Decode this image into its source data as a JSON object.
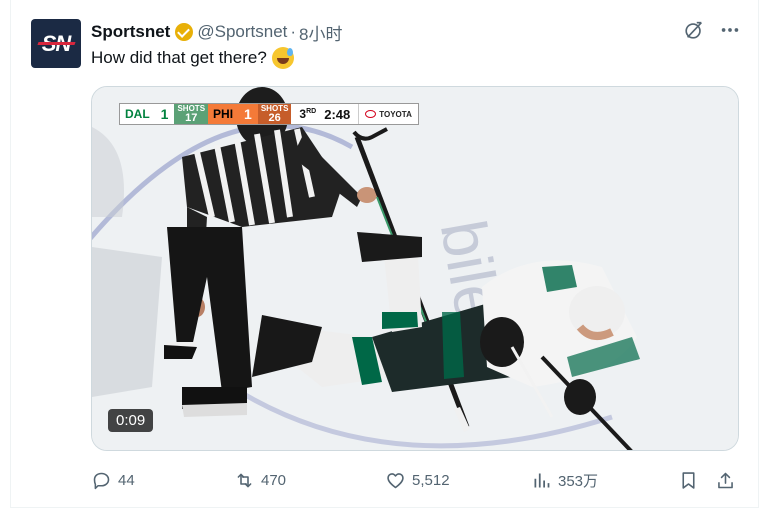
{
  "author": {
    "display_name": "Sportsnet",
    "handle": "@Sportsnet",
    "time": "8小时",
    "avatar_text": "SN",
    "verified_color": "#e8b008"
  },
  "tweet": {
    "text": "How did that get there?",
    "emoji": "sweat-smile-emoji"
  },
  "media": {
    "scorebug": {
      "team1": "DAL",
      "team1_score": "1",
      "team1_shots_label": "SHOTS",
      "team1_shots": "17",
      "team2": "PHI",
      "team2_score": "1",
      "team2_shots_label": "SHOTS",
      "team2_shots": "26",
      "period": "3",
      "period_suffix": "RD",
      "clock": "2:48",
      "sponsor": "TOYOTA"
    },
    "duration": "0:09"
  },
  "actions": {
    "replies": "44",
    "reposts": "470",
    "likes": "5,512",
    "views": "353万"
  },
  "colors": {
    "text_primary": "#0f1419",
    "text_secondary": "#536471",
    "dal_green": "#00823e",
    "phi_orange": "#f47a38"
  }
}
